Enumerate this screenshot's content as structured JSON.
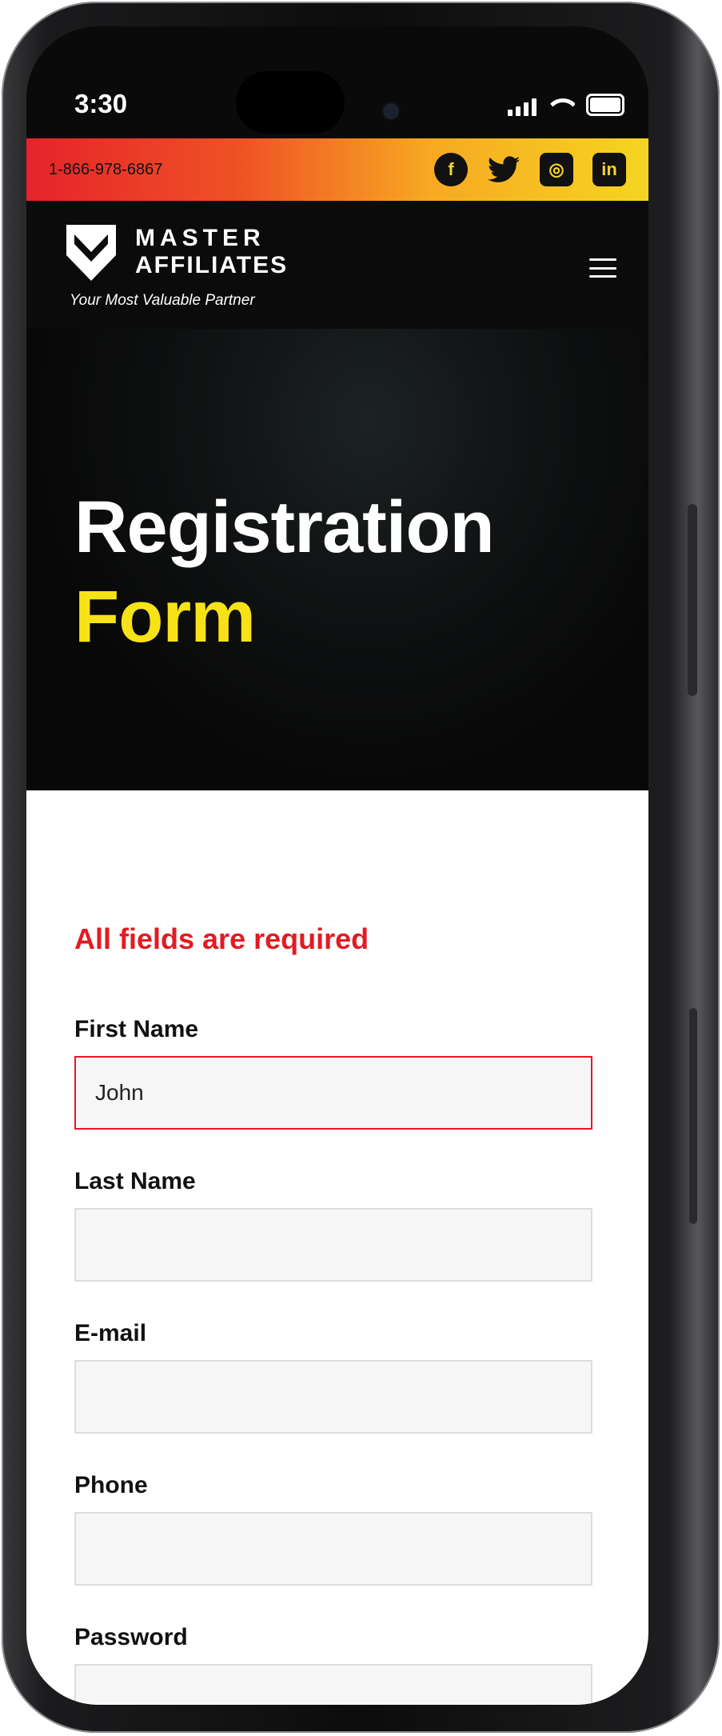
{
  "status_bar": {
    "time": "3:30"
  },
  "topbar": {
    "phone": "1-866-978-6867",
    "socials": [
      {
        "icon": "facebook-icon",
        "glyph": "f"
      },
      {
        "icon": "twitter-icon",
        "glyph": "🐦"
      },
      {
        "icon": "instagram-icon",
        "glyph": "◎"
      },
      {
        "icon": "linkedin-icon",
        "glyph": "in"
      }
    ]
  },
  "header": {
    "logo_line1": "MASTER",
    "logo_line2": "AFFILIATES",
    "tagline": "Your Most Valuable Partner"
  },
  "hero": {
    "title_line1": "Registration",
    "title_line2": "Form"
  },
  "form": {
    "required_note": "All fields are required",
    "fields": [
      {
        "label": "First Name",
        "value": "John"
      },
      {
        "label": "Last Name",
        "value": ""
      },
      {
        "label": "E-mail",
        "value": ""
      },
      {
        "label": "Phone",
        "value": ""
      },
      {
        "label": "Password",
        "value": ""
      }
    ]
  },
  "colors": {
    "accent_red": "#e21b23",
    "accent_yellow": "#f7e217",
    "dark_bg": "#0b0b0b",
    "gradient": [
      "#e6232a",
      "#f7a922",
      "#f5d521"
    ]
  }
}
